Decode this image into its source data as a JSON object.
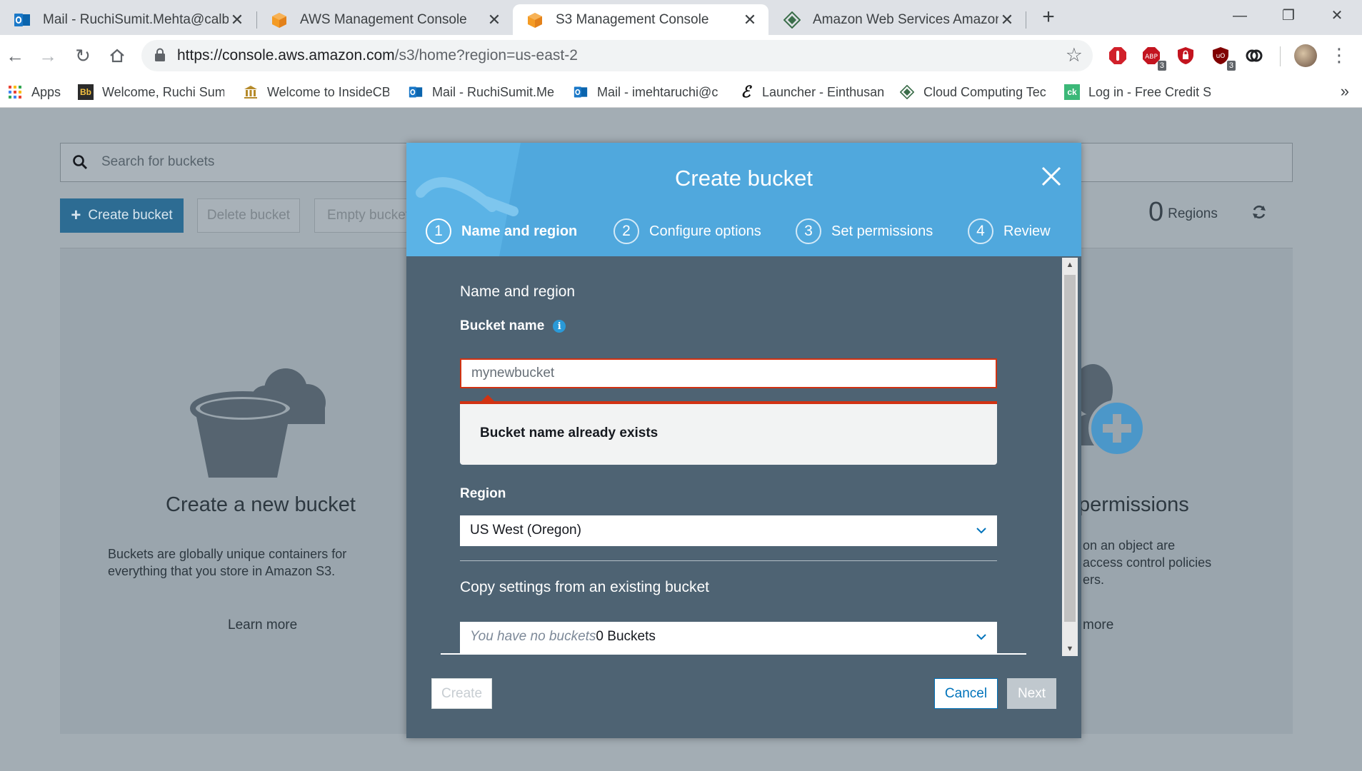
{
  "browser": {
    "tabs": [
      {
        "title": "Mail - RuchiSumit.Mehta@calbap",
        "icon": "outlook-icon"
      },
      {
        "title": "AWS Management Console",
        "icon": "aws-cube-icon"
      },
      {
        "title": "S3 Management Console",
        "icon": "aws-cube-icon",
        "active": true
      },
      {
        "title": "Amazon Web Services Amazon S",
        "icon": "diamond-logo-icon"
      }
    ],
    "url_host": "https://console.aws.amazon.com",
    "url_path": "/s3/home?region=us-east-2",
    "extension_badges": [
      "3",
      "3"
    ],
    "bookmarks": [
      {
        "label": "Apps"
      },
      {
        "label": "Welcome, Ruchi Sum"
      },
      {
        "label": "Welcome to InsideCB"
      },
      {
        "label": "Mail - RuchiSumit.Me"
      },
      {
        "label": "Mail - imehtaruchi@c"
      },
      {
        "label": "Launcher - Einthusan"
      },
      {
        "label": "Cloud Computing Tec"
      },
      {
        "label": "Log in - Free Credit S"
      }
    ],
    "bookmarks_more": "»"
  },
  "s3_page": {
    "search_placeholder": "Search for buckets",
    "create_bucket_label": "Create bucket",
    "delete_bucket_label": "Delete bucket",
    "empty_bucket_label": "Empty bucket",
    "regions_count": "0",
    "regions_label": "Regions",
    "panel_left": {
      "title": "Create a new bucket",
      "text_line1": "Buckets are globally unique containers for",
      "text_line2": "everything that you store in Amazon S3.",
      "link": "Learn more"
    },
    "panel_right": {
      "title": "permissions",
      "text_line1": "on an object are",
      "text_line2": "access control policies",
      "text_line3": "ers.",
      "link": "more"
    }
  },
  "modal": {
    "title": "Create bucket",
    "steps": [
      {
        "num": "1",
        "label": "Name and region",
        "active": true
      },
      {
        "num": "2",
        "label": "Configure options"
      },
      {
        "num": "3",
        "label": "Set permissions"
      },
      {
        "num": "4",
        "label": "Review"
      }
    ],
    "section_title": "Name and region",
    "bucket_name_label": "Bucket name",
    "bucket_name_value": "mynewbucket",
    "error_message": "Bucket name already exists",
    "region_label": "Region",
    "region_value": "US West (Oregon)",
    "copy_title": "Copy settings from an existing bucket",
    "copy_placeholder": "You have no buckets",
    "copy_count": "0 Buckets",
    "buttons": {
      "create": "Create",
      "cancel": "Cancel",
      "next": "Next"
    }
  },
  "colors": {
    "modal_header": "#50a8dd",
    "modal_body": "#4e6373",
    "error_red": "#d13212",
    "link_blue": "#0073bb"
  }
}
